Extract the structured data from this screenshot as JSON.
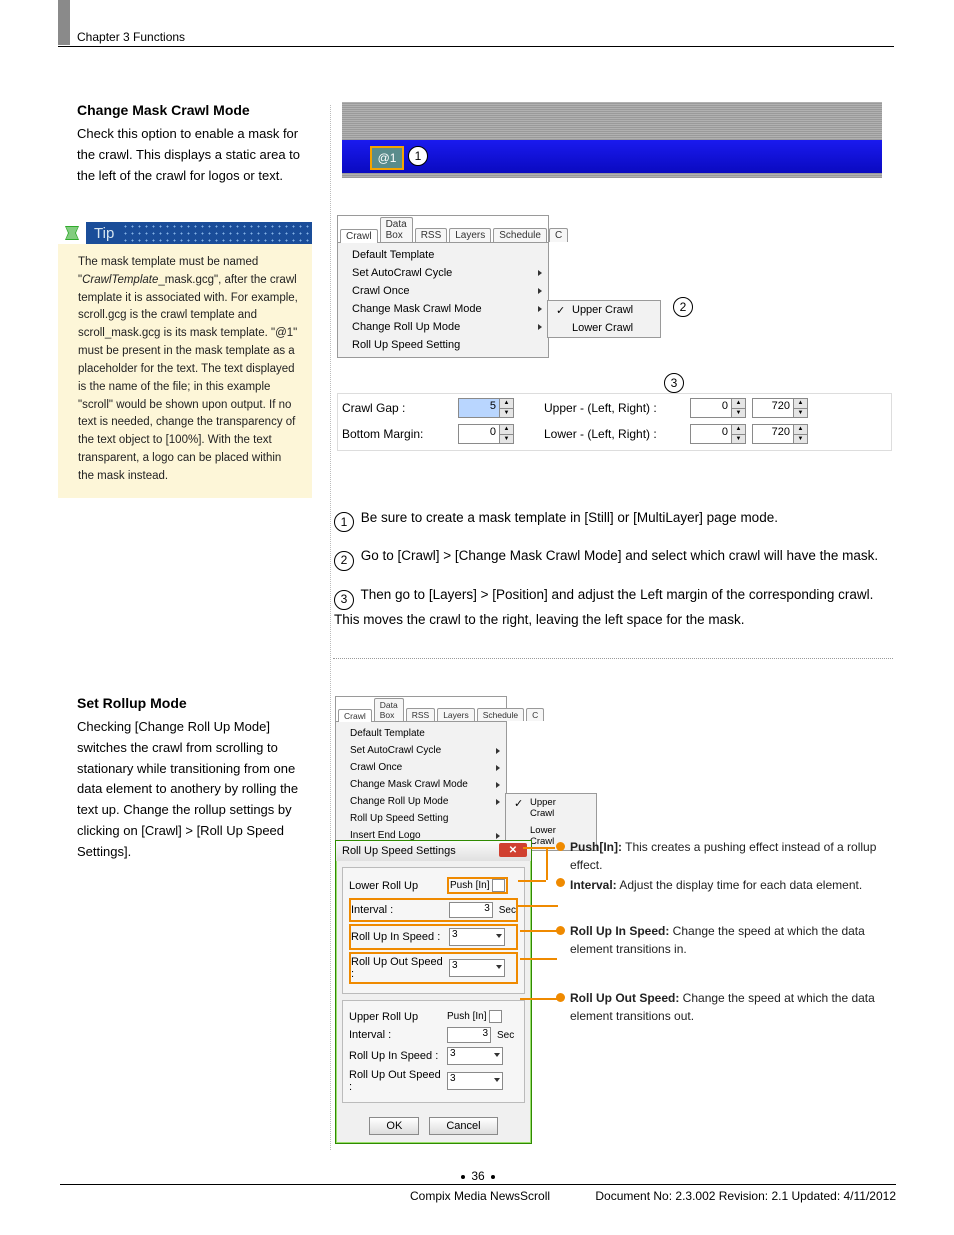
{
  "chapter": "Chapter 3 Functions",
  "section1": {
    "title": "Change Mask Crawl Mode",
    "body": "Check this option to enable a mask for the crawl. This displays a static area to the left of the crawl for logos or text."
  },
  "tip": {
    "label": "Tip",
    "body_pre": "The mask template must be named \"",
    "body_em": "CrawlTemplate",
    "body_post": "_mask.gcg\", after the crawl template it is associated with. For example, scroll.gcg is the crawl template and scroll_mask.gcg is its mask template. \"@1\" must be present in the mask template as a placeholder for the text. The text displayed is the name of the file; in this example \"scroll\" would be shown upon output. If no text is needed, change the transparency of the text object to [100%]. With the text transparent, a logo can be placed within the mask instead."
  },
  "at1": "@1",
  "menu1": {
    "tabs": [
      "Crawl",
      "Data Box",
      "RSS",
      "Layers",
      "Schedule",
      "C"
    ],
    "items": [
      "Default Template",
      "Set AutoCrawl Cycle",
      "Crawl Once",
      "Change Mask Crawl Mode",
      "Change Roll Up Mode",
      "Roll Up Speed Setting"
    ],
    "sub": [
      "Upper Crawl",
      "Lower Crawl"
    ]
  },
  "fields": {
    "gap_label": "Crawl Gap  :",
    "gap_val": "5",
    "bm_label": "Bottom Margin:",
    "bm_val": "0",
    "upper_label": "Upper - (Left, Right) :",
    "upper_l": "0",
    "upper_r": "720",
    "lower_label": "Lower - (Left, Right) :",
    "lower_l": "0",
    "lower_r": "720"
  },
  "steps": {
    "s1": "Be sure to create a mask template in [Still] or [MultiLayer] page mode.",
    "s2": "Go to [Crawl] > [Change Mask Crawl Mode] and select which crawl will have the mask.",
    "s3": "Then go to [Layers] > [Position] and adjust the Left margin of the corresponding crawl. This moves the crawl to the right, leaving the left space for the mask."
  },
  "section2": {
    "title": "Set Rollup Mode",
    "body": "Checking [Change Roll Up Mode] switches the crawl from scrolling to stationary while transitioning from one data element to anothery by rolling the text up. Change the rollup settings by clicking on [Crawl] > [Roll Up Speed Settings]."
  },
  "menu2_extra": "Insert End Logo",
  "rollup": {
    "title": "Roll Up  Speed Settings",
    "lower": "Lower Roll Up",
    "upper": "Upper Roll Up",
    "pushin": "Push [In]",
    "interval": "Interval :",
    "interval_val": "3",
    "sec": "Sec",
    "inspd": "Roll Up In Speed :",
    "outspd": "Roll Up Out Speed :",
    "spd_val": "3",
    "ok": "OK",
    "cancel": "Cancel"
  },
  "callouts": {
    "pushin_b": "Push[In]:",
    "pushin": " This creates a pushing effect instead of a rollup effect.",
    "interval_b": "Interval:",
    "interval": " Adjust the display time for each data element.",
    "inspd_b": "Roll Up In Speed:",
    "inspd": " Change the speed at which the data element transitions in.",
    "outspd_b": "Roll Up Out Speed:",
    "outspd": " Change the speed at which the data element transitions out."
  },
  "footer": {
    "page": "36",
    "left": "Compix Media NewsScroll",
    "right": "Document No: 2.3.002 Revision: 2.1 Updated: 4/11/2012"
  }
}
